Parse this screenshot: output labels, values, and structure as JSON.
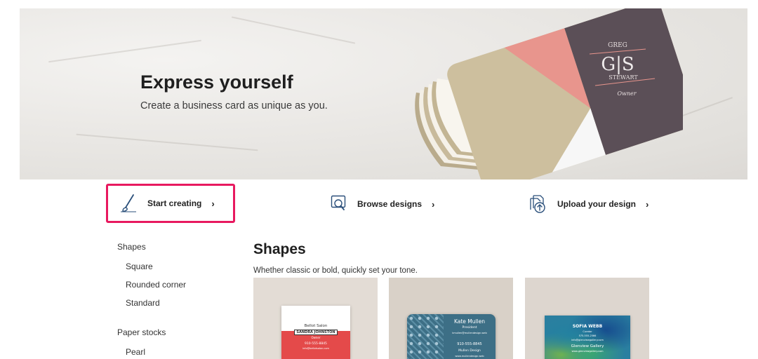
{
  "hero": {
    "title": "Express yourself",
    "subtitle": "Create a business card as unique as you.",
    "card": {
      "name_top": "GREG",
      "monogram": "G|S",
      "name_bottom": "STEWART",
      "role": "Owner"
    }
  },
  "actions": [
    {
      "label": "Start creating",
      "icon": "paintbrush-icon"
    },
    {
      "label": "Browse designs",
      "icon": "magnifier-card-icon"
    },
    {
      "label": "Upload your design",
      "icon": "upload-icon"
    }
  ],
  "action_chevron": "›",
  "sidebar": {
    "sections": [
      {
        "title": "Shapes",
        "items": [
          "Square",
          "Rounded corner",
          "Standard"
        ]
      },
      {
        "title": "Paper stocks",
        "items": [
          "Pearl"
        ]
      }
    ]
  },
  "main": {
    "title": "Shapes",
    "description": "Whether classic or bold, quickly set your tone.",
    "tiles": [
      {
        "lines": [
          "Bellot Salon",
          "SANDRA JOHNSTON",
          "Owner",
          "910-555-8845",
          "info@bellotsalon.com"
        ]
      },
      {
        "lines": [
          "Kate Mullen",
          "President",
          "kmullen@mullendesign.web",
          "910-555-8845",
          "Mullen Design",
          "www.mullendesign.web"
        ]
      },
      {
        "lines": [
          "SOFIA WEBB",
          "Curator",
          "575-555-2566",
          "info@glenviewgallery.com",
          "Glenview Gallery",
          "www.glenviewgallery.com"
        ]
      }
    ]
  },
  "colors": {
    "highlight": "#e8195f",
    "card_pink": "#e8958d",
    "card_slate": "#5b4f57",
    "card_gold": "#cdbf9e"
  }
}
